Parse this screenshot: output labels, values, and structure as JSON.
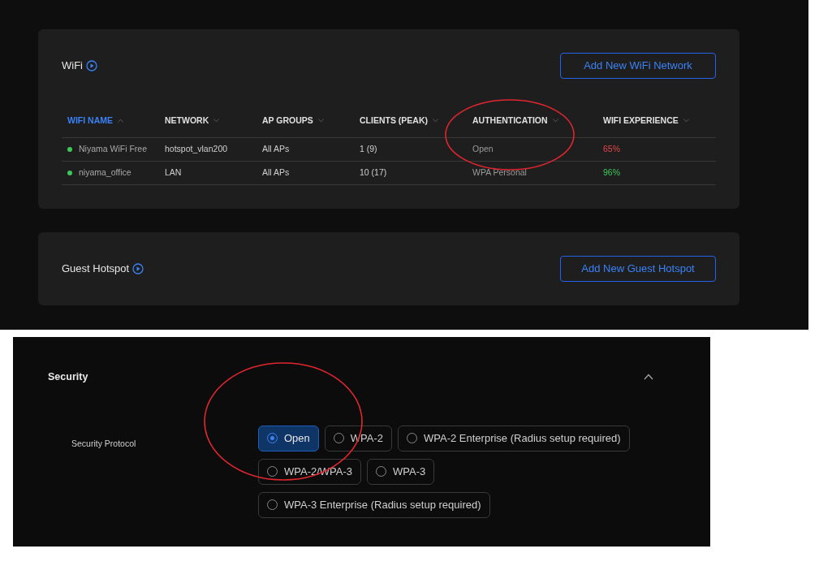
{
  "wifi_card": {
    "title": "WiFi",
    "button": "Add New WiFi Network",
    "columns": [
      {
        "label": "WIFI NAME",
        "selected": true
      },
      {
        "label": "NETWORK",
        "selected": false
      },
      {
        "label": "AP GROUPS",
        "selected": false
      },
      {
        "label": "CLIENTS (PEAK)",
        "selected": false
      },
      {
        "label": "AUTHENTICATION",
        "selected": false
      },
      {
        "label": "WIFI EXPERIENCE",
        "selected": false
      }
    ],
    "rows": [
      {
        "name": "Niyama WiFi Free",
        "color": "#3ec65a",
        "network": "hotspot_vlan200",
        "ap_groups": "All APs",
        "clients": "1 (9)",
        "authentication": "Open",
        "experience": {
          "text": "65%",
          "warning": true
        }
      },
      {
        "name": "niyama_office",
        "color": "#3ec65a",
        "network": "LAN",
        "ap_groups": "All APs",
        "clients": "10 (17)",
        "authentication": "WPA Personal",
        "experience": {
          "text": "96%",
          "warning": false
        }
      }
    ]
  },
  "guest_card": {
    "title": "Guest Hotspot",
    "button": "Add New Guest Hotspot"
  },
  "security": {
    "title": "Security",
    "expanded": true,
    "field_label": "Security Protocol",
    "options": [
      {
        "label": "Open",
        "selected": true
      },
      {
        "label": "WPA-2",
        "selected": false
      },
      {
        "label": "WPA-2 Enterprise (Radius setup required)",
        "selected": false
      },
      {
        "label": "WPA-2/WPA-3",
        "selected": false
      },
      {
        "label": "WPA-3",
        "selected": false
      },
      {
        "label": "WPA-3 Enterprise (Radius setup required)",
        "selected": false
      }
    ]
  }
}
